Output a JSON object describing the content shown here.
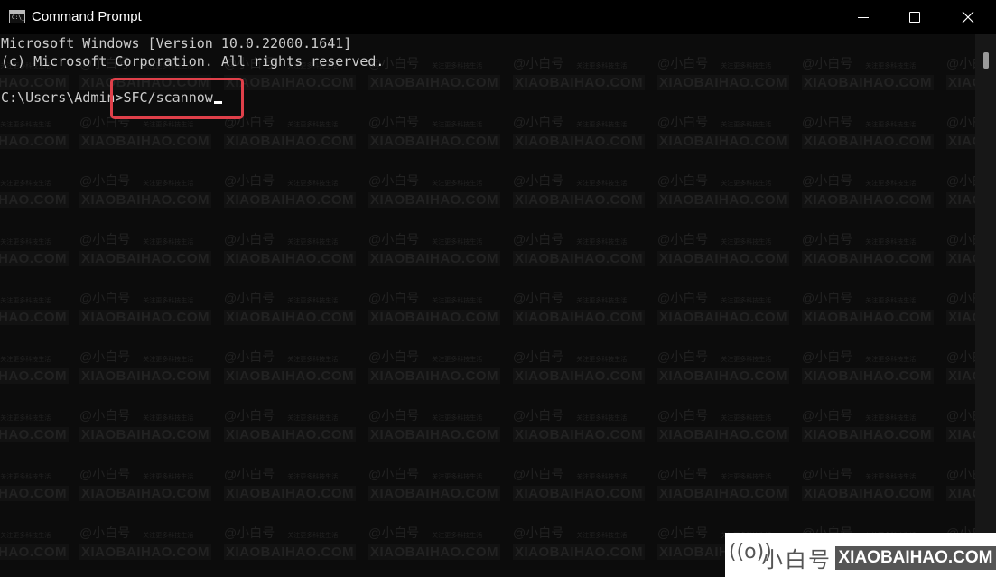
{
  "window": {
    "title": "Command Prompt",
    "icon": "cmd-icon",
    "controls": [
      "minimize",
      "maximize",
      "close"
    ]
  },
  "console": {
    "lines": [
      "Microsoft Windows [Version 10.0.22000.1641]",
      "(c) Microsoft Corporation. All rights reserved."
    ],
    "prompt": "C:\\Users\\Admin>",
    "command": "SFC/scannow"
  },
  "annotation": {
    "highlight_color": "#e0404a"
  },
  "watermark": {
    "handle": "@小白号",
    "slogan": "关注更多科技生活",
    "site": "XIAOBAIHAO.COM"
  },
  "brand": {
    "icon": "broadcast-icon",
    "icon_glyph": "((o))",
    "name_cn": "小白号",
    "site": "XIAOBAIHAO.COM"
  }
}
